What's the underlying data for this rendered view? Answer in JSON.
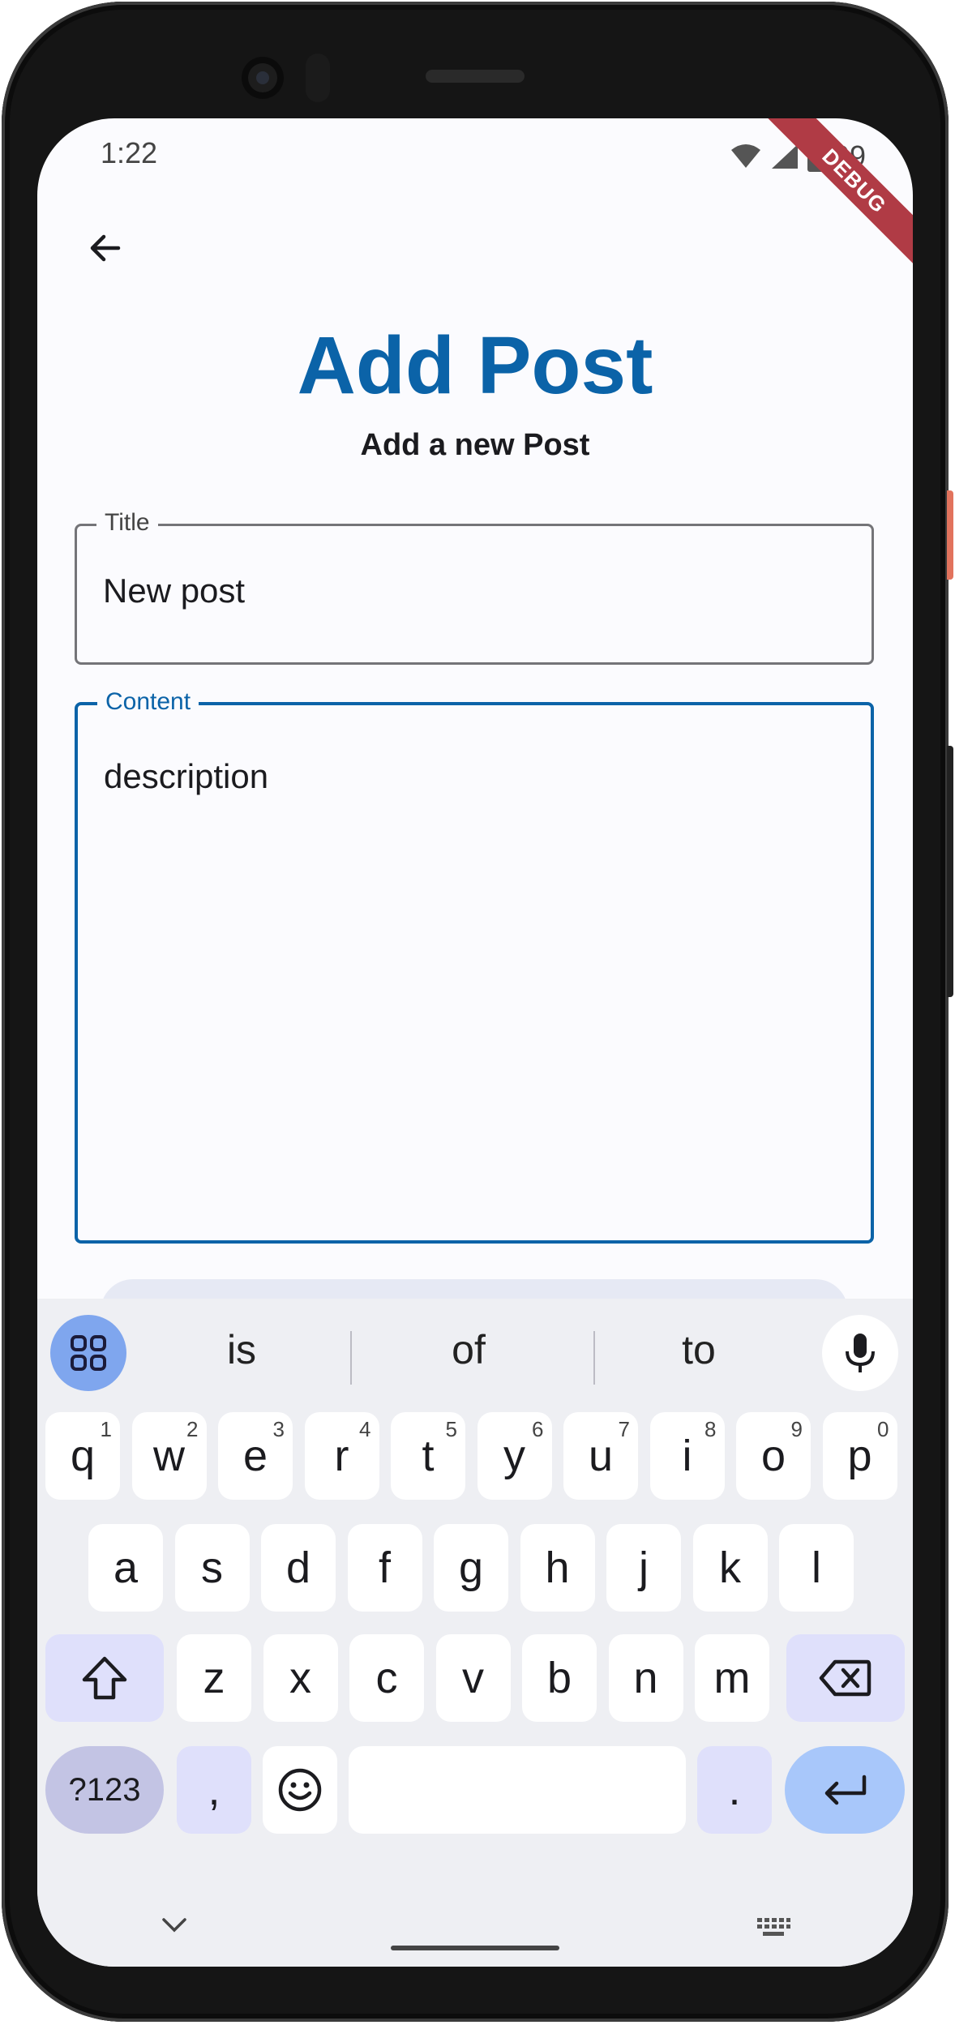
{
  "status_bar": {
    "time": "1:22",
    "battery": "99",
    "debug_banner": "DEBUG"
  },
  "header": {
    "back_icon": "arrow-back-icon",
    "title": "Add Post",
    "subtitle": "Add a new Post"
  },
  "form": {
    "title_field": {
      "label": "Title",
      "value": "New post"
    },
    "content_field": {
      "label": "Content",
      "value": "description"
    }
  },
  "keyboard": {
    "suggestions": [
      "is",
      "of",
      "to"
    ],
    "row1": [
      {
        "k": "q",
        "n": "1"
      },
      {
        "k": "w",
        "n": "2"
      },
      {
        "k": "e",
        "n": "3"
      },
      {
        "k": "r",
        "n": "4"
      },
      {
        "k": "t",
        "n": "5"
      },
      {
        "k": "y",
        "n": "6"
      },
      {
        "k": "u",
        "n": "7"
      },
      {
        "k": "i",
        "n": "8"
      },
      {
        "k": "o",
        "n": "9"
      },
      {
        "k": "p",
        "n": "0"
      }
    ],
    "row2": [
      "a",
      "s",
      "d",
      "f",
      "g",
      "h",
      "j",
      "k",
      "l"
    ],
    "row3": [
      "z",
      "x",
      "c",
      "v",
      "b",
      "n",
      "m"
    ],
    "numbers_key": "?123",
    "comma_key": ",",
    "period_key": "."
  },
  "colors": {
    "accent": "#0b63a8",
    "keyboard_bg": "#eeeff3",
    "debug_ribbon": "#b03b45"
  }
}
